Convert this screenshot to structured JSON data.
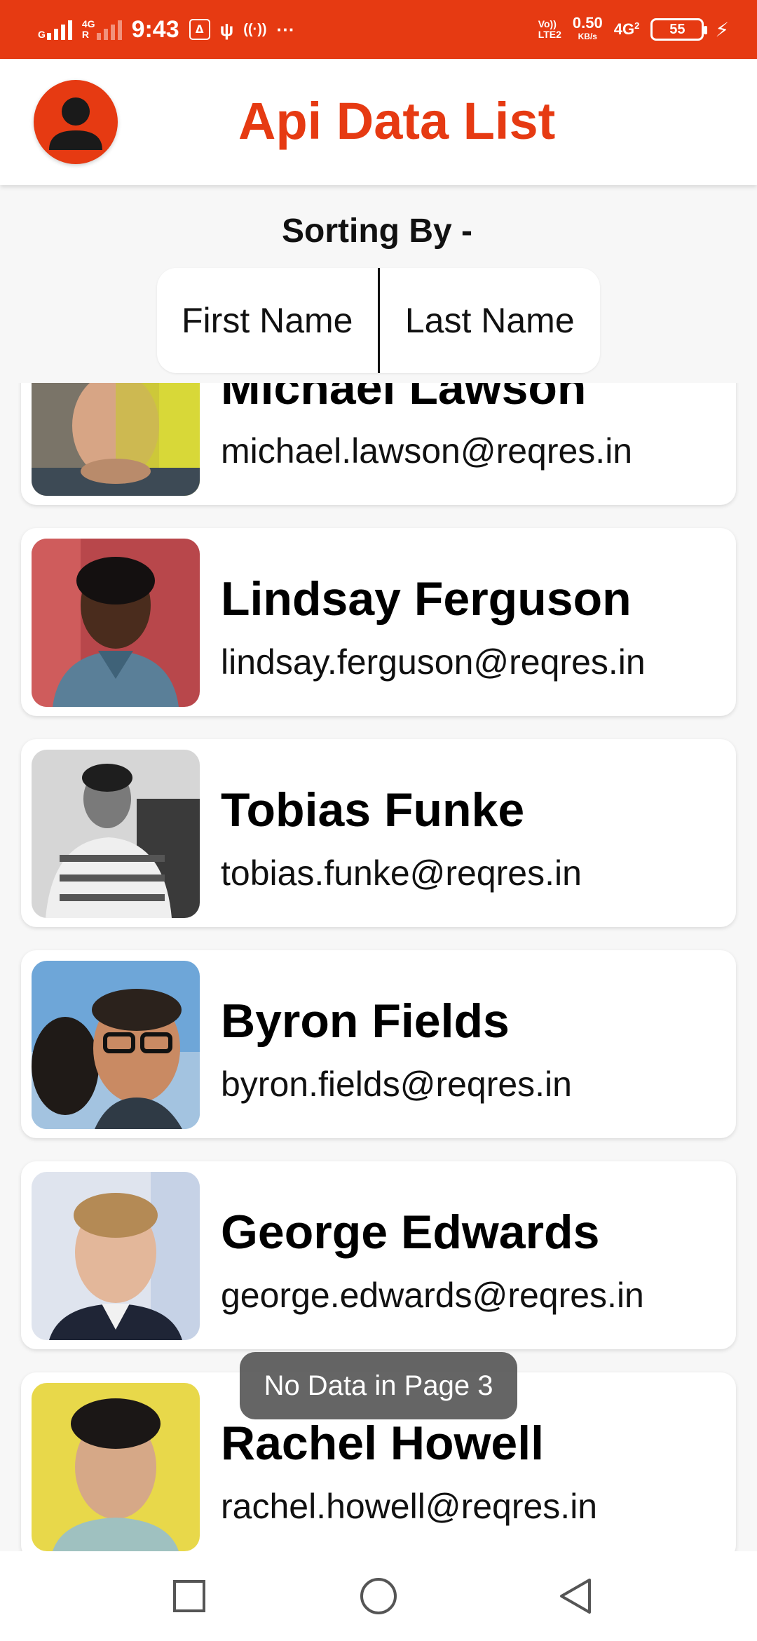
{
  "status_bar": {
    "net_left_top": "G",
    "net_left_bottom": "4G",
    "net_left_sub": "R",
    "time": "9:43",
    "volte_top": "Vo))",
    "volte_bottom": "LTE2",
    "speed_value": "0.50",
    "speed_unit": "KB/s",
    "net_right": "4G",
    "net_right_sub": "2",
    "battery": "55",
    "dots": "···"
  },
  "app_bar": {
    "title": "Api Data List"
  },
  "sorting": {
    "label": "Sorting By -",
    "options": [
      "First Name",
      "Last Name"
    ]
  },
  "users": [
    {
      "name": "Michael Lawson",
      "email": "michael.lawson@reqres.in"
    },
    {
      "name": "Lindsay Ferguson",
      "email": "lindsay.ferguson@reqres.in"
    },
    {
      "name": "Tobias Funke",
      "email": "tobias.funke@reqres.in"
    },
    {
      "name": "Byron Fields",
      "email": "byron.fields@reqres.in"
    },
    {
      "name": "George Edwards",
      "email": "george.edwards@reqres.in"
    },
    {
      "name": "Rachel Howell",
      "email": "rachel.howell@reqres.in"
    }
  ],
  "toast": "No Data in Page 3",
  "nav": {
    "recents": "square-icon",
    "home": "circle-icon",
    "back": "triangle-back-icon"
  },
  "colors": {
    "accent": "#e63a12"
  }
}
